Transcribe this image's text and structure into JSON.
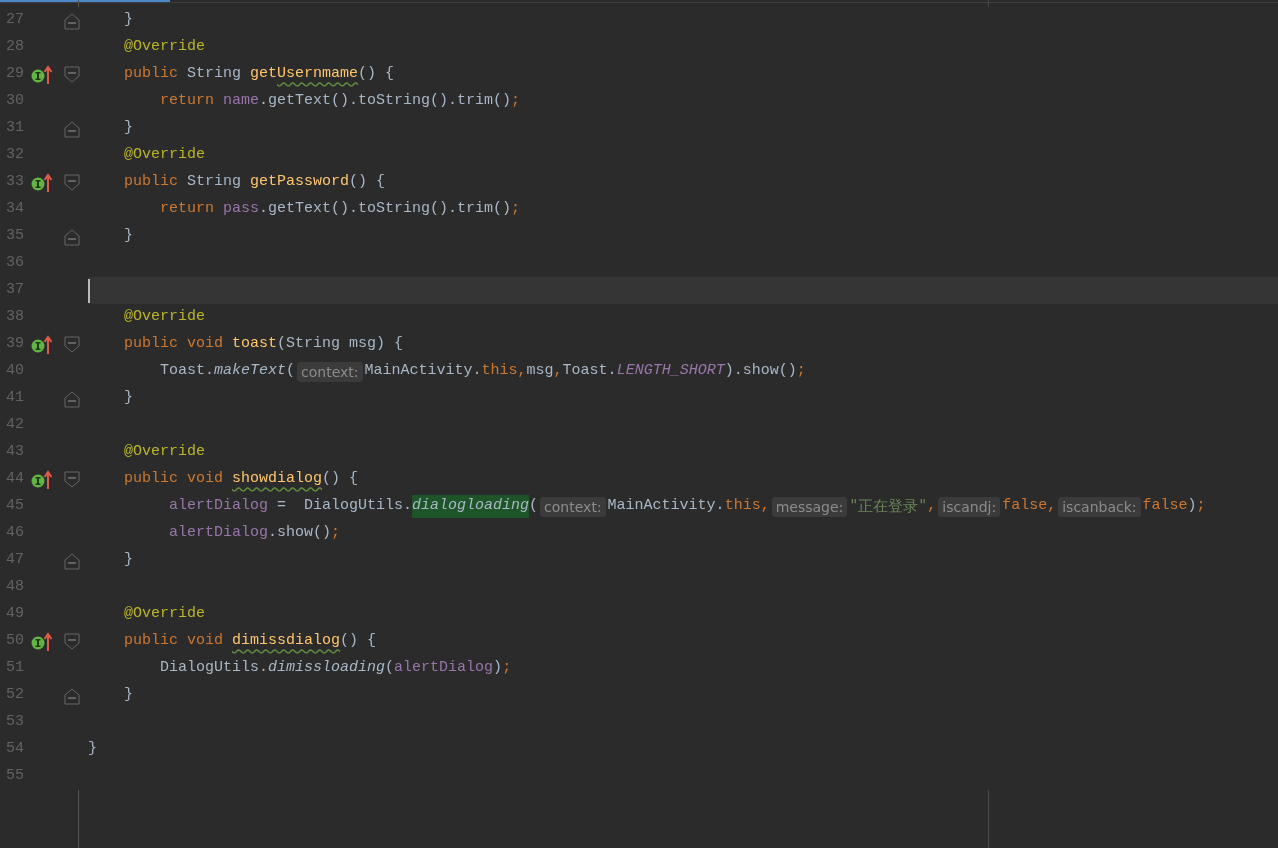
{
  "editor": {
    "lines": [
      {
        "number": "27",
        "marker": false,
        "fold_start": false,
        "fold_end": true,
        "current": false,
        "kind": "member",
        "tokens": [
          {
            "t": "}",
            "kind": "plain"
          }
        ]
      },
      {
        "number": "28",
        "marker": false,
        "fold_start": false,
        "fold_end": false,
        "current": false,
        "kind": "member",
        "tokens": [
          {
            "t": "@Override",
            "kind": "annotation"
          }
        ]
      },
      {
        "number": "29",
        "marker": true,
        "fold_start": true,
        "fold_end": false,
        "current": false,
        "kind": "member",
        "tokens": [
          {
            "t": "public ",
            "kind": "keyword"
          },
          {
            "t": "String ",
            "kind": "plain"
          },
          {
            "t": "get",
            "kind": "decl"
          },
          {
            "t": "Usernmame",
            "kind": "typo"
          },
          {
            "t": "() {",
            "kind": "plain"
          }
        ]
      },
      {
        "number": "30",
        "marker": false,
        "fold_start": false,
        "fold_end": false,
        "current": false,
        "kind": "body",
        "tokens": [
          {
            "t": "return ",
            "kind": "keyword"
          },
          {
            "t": "name",
            "kind": "field"
          },
          {
            "t": ".getText().toString().trim()",
            "kind": "plain"
          },
          {
            "t": ";",
            "kind": "keyword"
          }
        ]
      },
      {
        "number": "31",
        "marker": false,
        "fold_start": false,
        "fold_end": true,
        "current": false,
        "kind": "member",
        "tokens": [
          {
            "t": "}",
            "kind": "plain"
          }
        ]
      },
      {
        "number": "32",
        "marker": false,
        "fold_start": false,
        "fold_end": false,
        "current": false,
        "kind": "member",
        "tokens": [
          {
            "t": "@Override",
            "kind": "annotation"
          }
        ]
      },
      {
        "number": "33",
        "marker": true,
        "fold_start": true,
        "fold_end": false,
        "current": false,
        "kind": "member",
        "tokens": [
          {
            "t": "public ",
            "kind": "keyword"
          },
          {
            "t": "String ",
            "kind": "plain"
          },
          {
            "t": "getPassword",
            "kind": "decl"
          },
          {
            "t": "() {",
            "kind": "plain"
          }
        ]
      },
      {
        "number": "34",
        "marker": false,
        "fold_start": false,
        "fold_end": false,
        "current": false,
        "kind": "body",
        "tokens": [
          {
            "t": "return ",
            "kind": "keyword"
          },
          {
            "t": "pass",
            "kind": "field"
          },
          {
            "t": ".getText().toString().trim()",
            "kind": "plain"
          },
          {
            "t": ";",
            "kind": "keyword"
          }
        ]
      },
      {
        "number": "35",
        "marker": false,
        "fold_start": false,
        "fold_end": true,
        "current": false,
        "kind": "member",
        "tokens": [
          {
            "t": "}",
            "kind": "plain"
          }
        ]
      },
      {
        "number": "36",
        "marker": false,
        "fold_start": false,
        "fold_end": false,
        "current": false,
        "kind": "top"
      },
      {
        "number": "37",
        "marker": false,
        "fold_start": false,
        "fold_end": false,
        "current": true,
        "kind": "top"
      },
      {
        "number": "38",
        "marker": false,
        "fold_start": false,
        "fold_end": false,
        "current": false,
        "kind": "member",
        "tokens": [
          {
            "t": "@Override",
            "kind": "annotation"
          }
        ]
      },
      {
        "number": "39",
        "marker": true,
        "fold_start": true,
        "fold_end": false,
        "current": false,
        "kind": "member",
        "tokens": [
          {
            "t": "public void ",
            "kind": "keyword"
          },
          {
            "t": "toast",
            "kind": "decl"
          },
          {
            "t": "(String msg) {",
            "kind": "plain"
          }
        ]
      },
      {
        "number": "40",
        "marker": false,
        "fold_start": false,
        "fold_end": false,
        "current": false,
        "kind": "body",
        "tokens": [
          {
            "t": "Toast.",
            "kind": "plain"
          },
          {
            "t": "makeText",
            "kind": "static"
          },
          {
            "t": "(",
            "kind": "plain"
          },
          {
            "t": "context:",
            "kind": "hint"
          },
          {
            "t": "MainActivity.",
            "kind": "plain"
          },
          {
            "t": "this,",
            "kind": "keyword"
          },
          {
            "t": "msg",
            "kind": "plain"
          },
          {
            "t": ",",
            "kind": "keyword"
          },
          {
            "t": "Toast.",
            "kind": "plain"
          },
          {
            "t": "LENGTH_SHORT",
            "kind": "constant"
          },
          {
            "t": ").show()",
            "kind": "plain"
          },
          {
            "t": ";",
            "kind": "keyword"
          }
        ]
      },
      {
        "number": "41",
        "marker": false,
        "fold_start": false,
        "fold_end": true,
        "current": false,
        "kind": "member",
        "tokens": [
          {
            "t": "}",
            "kind": "plain"
          }
        ]
      },
      {
        "number": "42",
        "marker": false,
        "fold_start": false,
        "fold_end": false,
        "current": false,
        "kind": "top"
      },
      {
        "number": "43",
        "marker": false,
        "fold_start": false,
        "fold_end": false,
        "current": false,
        "kind": "member",
        "tokens": [
          {
            "t": "@Override",
            "kind": "annotation"
          }
        ]
      },
      {
        "number": "44",
        "marker": true,
        "fold_start": true,
        "fold_end": false,
        "current": false,
        "kind": "member",
        "tokens": [
          {
            "t": "public void ",
            "kind": "keyword"
          },
          {
            "t": "showdialog",
            "kind": "typo"
          },
          {
            "t": "() {",
            "kind": "plain"
          }
        ]
      },
      {
        "number": "45",
        "marker": false,
        "fold_start": false,
        "fold_end": false,
        "current": false,
        "kind": "body-wide",
        "tokens": [
          {
            "t": "alertDialog",
            "kind": "field"
          },
          {
            "t": " =  DialogUtils.",
            "kind": "plain"
          },
          {
            "t": "dialogloading",
            "kind": "match"
          },
          {
            "t": "(",
            "kind": "plain"
          },
          {
            "t": "context:",
            "kind": "hint"
          },
          {
            "t": "MainActivity.",
            "kind": "plain"
          },
          {
            "t": "this,",
            "kind": "keyword"
          },
          {
            "t": "message:",
            "kind": "hint"
          },
          {
            "t": "\"正在登录\"",
            "kind": "string"
          },
          {
            "t": ",",
            "kind": "keyword"
          },
          {
            "t": "iscandj:",
            "kind": "hint"
          },
          {
            "t": "false,",
            "kind": "keyword"
          },
          {
            "t": "iscanback:",
            "kind": "hint"
          },
          {
            "t": "false",
            "kind": "keyword"
          },
          {
            "t": ")",
            "kind": "plain"
          },
          {
            "t": ";",
            "kind": "keyword"
          }
        ]
      },
      {
        "number": "46",
        "marker": false,
        "fold_start": false,
        "fold_end": false,
        "current": false,
        "kind": "body-wide",
        "tokens": [
          {
            "t": "alertDialog",
            "kind": "field"
          },
          {
            "t": ".show()",
            "kind": "plain"
          },
          {
            "t": ";",
            "kind": "keyword"
          }
        ]
      },
      {
        "number": "47",
        "marker": false,
        "fold_start": false,
        "fold_end": true,
        "current": false,
        "kind": "member",
        "tokens": [
          {
            "t": "}",
            "kind": "plain"
          }
        ]
      },
      {
        "number": "48",
        "marker": false,
        "fold_start": false,
        "fold_end": false,
        "current": false,
        "kind": "top"
      },
      {
        "number": "49",
        "marker": false,
        "fold_start": false,
        "fold_end": false,
        "current": false,
        "kind": "member",
        "tokens": [
          {
            "t": "@Override",
            "kind": "annotation"
          }
        ]
      },
      {
        "number": "50",
        "marker": true,
        "fold_start": true,
        "fold_end": false,
        "current": false,
        "kind": "member",
        "tokens": [
          {
            "t": "public void ",
            "kind": "keyword"
          },
          {
            "t": "dimissdialog",
            "kind": "typo"
          },
          {
            "t": "() {",
            "kind": "plain"
          }
        ]
      },
      {
        "number": "51",
        "marker": false,
        "fold_start": false,
        "fold_end": false,
        "current": false,
        "kind": "body",
        "tokens": [
          {
            "t": "DialogUtils.",
            "kind": "plain"
          },
          {
            "t": "dimissloading",
            "kind": "static"
          },
          {
            "t": "(",
            "kind": "plain"
          },
          {
            "t": "alertDialog",
            "kind": "field"
          },
          {
            "t": ")",
            "kind": "plain"
          },
          {
            "t": ";",
            "kind": "keyword"
          }
        ]
      },
      {
        "number": "52",
        "marker": false,
        "fold_start": false,
        "fold_end": true,
        "current": false,
        "kind": "member",
        "tokens": [
          {
            "t": "}",
            "kind": "plain"
          }
        ]
      },
      {
        "number": "53",
        "marker": false,
        "fold_start": false,
        "fold_end": false,
        "current": false,
        "kind": "top"
      },
      {
        "number": "54",
        "marker": false,
        "fold_start": false,
        "fold_end": false,
        "current": false,
        "kind": "top",
        "tokens": [
          {
            "t": "}",
            "kind": "plain"
          }
        ]
      },
      {
        "number": "55",
        "marker": false,
        "fold_start": false,
        "fold_end": false,
        "current": false,
        "kind": "top"
      }
    ]
  }
}
